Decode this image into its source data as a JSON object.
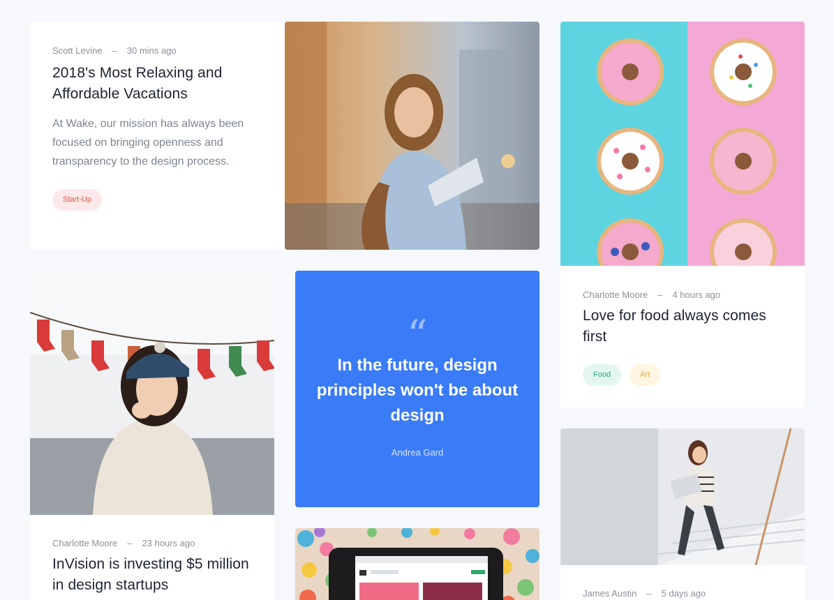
{
  "posts": [
    {
      "author": "Scott Levine",
      "time": "30 mins ago",
      "title": "2018's Most Relaxing and Affordable Vacations",
      "excerpt": "At Wake, our mission has always been focused on bringing openness and transparency to the design process.",
      "tags": [
        "Start-Up"
      ]
    },
    {
      "author": "Charlotte Moore",
      "time": "4 hours ago",
      "title": "Love for food always comes first",
      "tags": [
        "Food",
        "Art"
      ]
    },
    {
      "author": "Charlotte Moore",
      "time": "23 hours ago",
      "title": "InVision is investing $5 million in design startups"
    },
    {
      "author": "James Austin",
      "time": "5 days ago"
    }
  ],
  "quote": {
    "icon": "quote-icon",
    "text": "In the future, design principles won't be about design",
    "author": "Andrea Gard"
  },
  "meta_separator": "–",
  "colors": {
    "background": "#f6f8fb",
    "accent": "#3a7bf7",
    "tag_startup": "#d9534f",
    "tag_food": "#2ca57e",
    "tag_art": "#e8a93c"
  }
}
